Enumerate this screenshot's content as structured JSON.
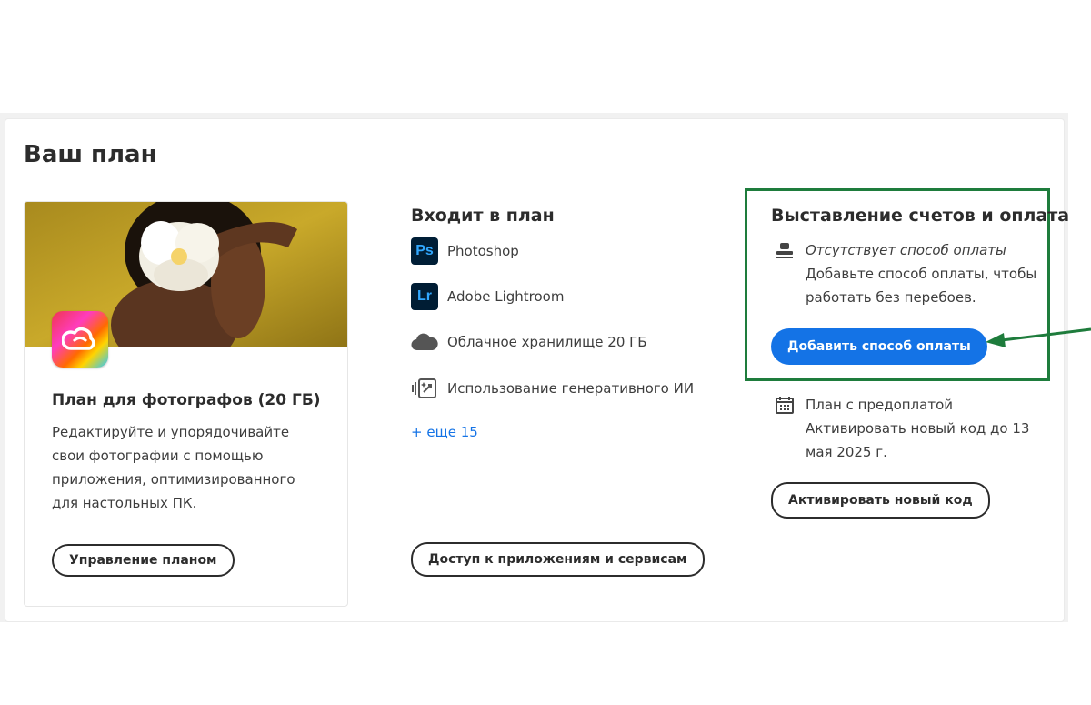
{
  "page": {
    "title": "Ваш план"
  },
  "plan_card": {
    "name": "План для фотографов (20 ГБ)",
    "description": "Редактируйте и упорядочивайте свои фотографии с помощью приложения, оптимизированного для настольных ПК.",
    "manage_label": "Управление планом"
  },
  "included": {
    "title": "Входит в план",
    "items": [
      {
        "icon": "ps-icon",
        "icon_text": "Ps",
        "label": "Photoshop"
      },
      {
        "icon": "lr-icon",
        "icon_text": "Lr",
        "label": "Adobe Lightroom"
      },
      {
        "icon": "cloud-icon",
        "label": "Облачное хранилище 20 ГБ"
      },
      {
        "icon": "generative-ai-icon",
        "label": "Использование генеративного ИИ"
      }
    ],
    "more_link": "+ еще 15",
    "access_label": "Доступ к приложениям и сервисам"
  },
  "billing": {
    "title": "Выставление счетов и оплата",
    "status": "Отсутствует способ оплаты",
    "message": "Добавьте способ оплаты, чтобы работать без перебоев.",
    "add_payment_label": "Добавить способ оплаты",
    "prepaid_title": "План с предоплатой",
    "prepaid_text": "Активировать новый код до 13 мая 2025 г.",
    "activate_label": "Активировать новый код"
  },
  "colors": {
    "accent": "#1473e6",
    "highlight_box": "#1e7c3c",
    "annotation_arrow": "#1e7c3c",
    "text": "#2c2c2c"
  }
}
